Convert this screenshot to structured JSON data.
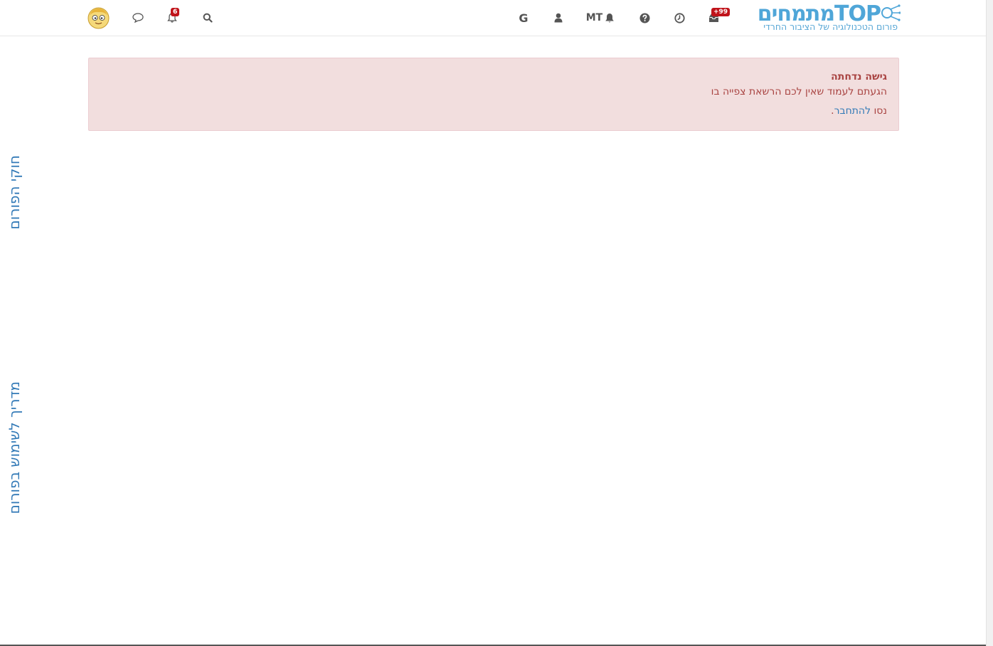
{
  "header": {
    "logo_text": "מתמחיםTOP",
    "logo_tagline": "פורום הטכנולוגיה של הציבור החרדי",
    "inbox_badge": "+99",
    "notifications_badge": "6",
    "mt_label": "MT",
    "google_label": "G"
  },
  "alert": {
    "title": "גישה נדחתה",
    "message": "הגעתם לעמוד שאין לכם הרשאת צפייה בו",
    "try_prefix": "נסו ",
    "login_link": "להתחבר",
    "try_suffix": "."
  },
  "side_links": {
    "rules": "חוקי הפורום",
    "guide": "מדריך לשימוש בפורום"
  },
  "colors": {
    "brand": "#4fa6d8",
    "alert_bg": "#f2dede",
    "alert_text": "#a94442",
    "link": "#337ab7",
    "badge": "#c0131a"
  }
}
